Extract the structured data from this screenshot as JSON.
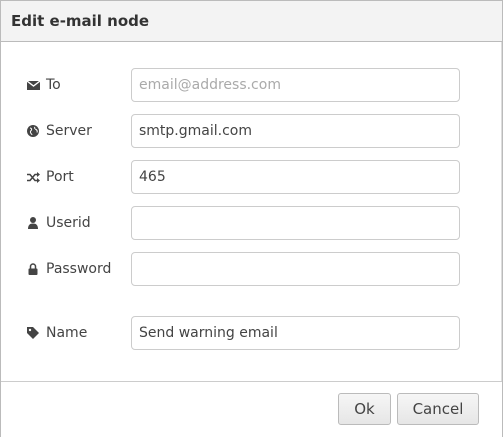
{
  "dialog": {
    "title": "Edit e-mail node"
  },
  "form": {
    "to": {
      "label": "To",
      "icon": "envelope-icon",
      "value": "",
      "placeholder": "email@address.com"
    },
    "server": {
      "label": "Server",
      "icon": "globe-icon",
      "value": "smtp.gmail.com",
      "placeholder": ""
    },
    "port": {
      "label": "Port",
      "icon": "random-icon",
      "value": "465",
      "placeholder": ""
    },
    "userid": {
      "label": "Userid",
      "icon": "user-icon",
      "value": "",
      "placeholder": ""
    },
    "password": {
      "label": "Password",
      "icon": "lock-icon",
      "value": "",
      "placeholder": ""
    },
    "name": {
      "label": "Name",
      "icon": "tag-icon",
      "value": "Send warning email",
      "placeholder": ""
    }
  },
  "buttons": {
    "ok": "Ok",
    "cancel": "Cancel"
  }
}
